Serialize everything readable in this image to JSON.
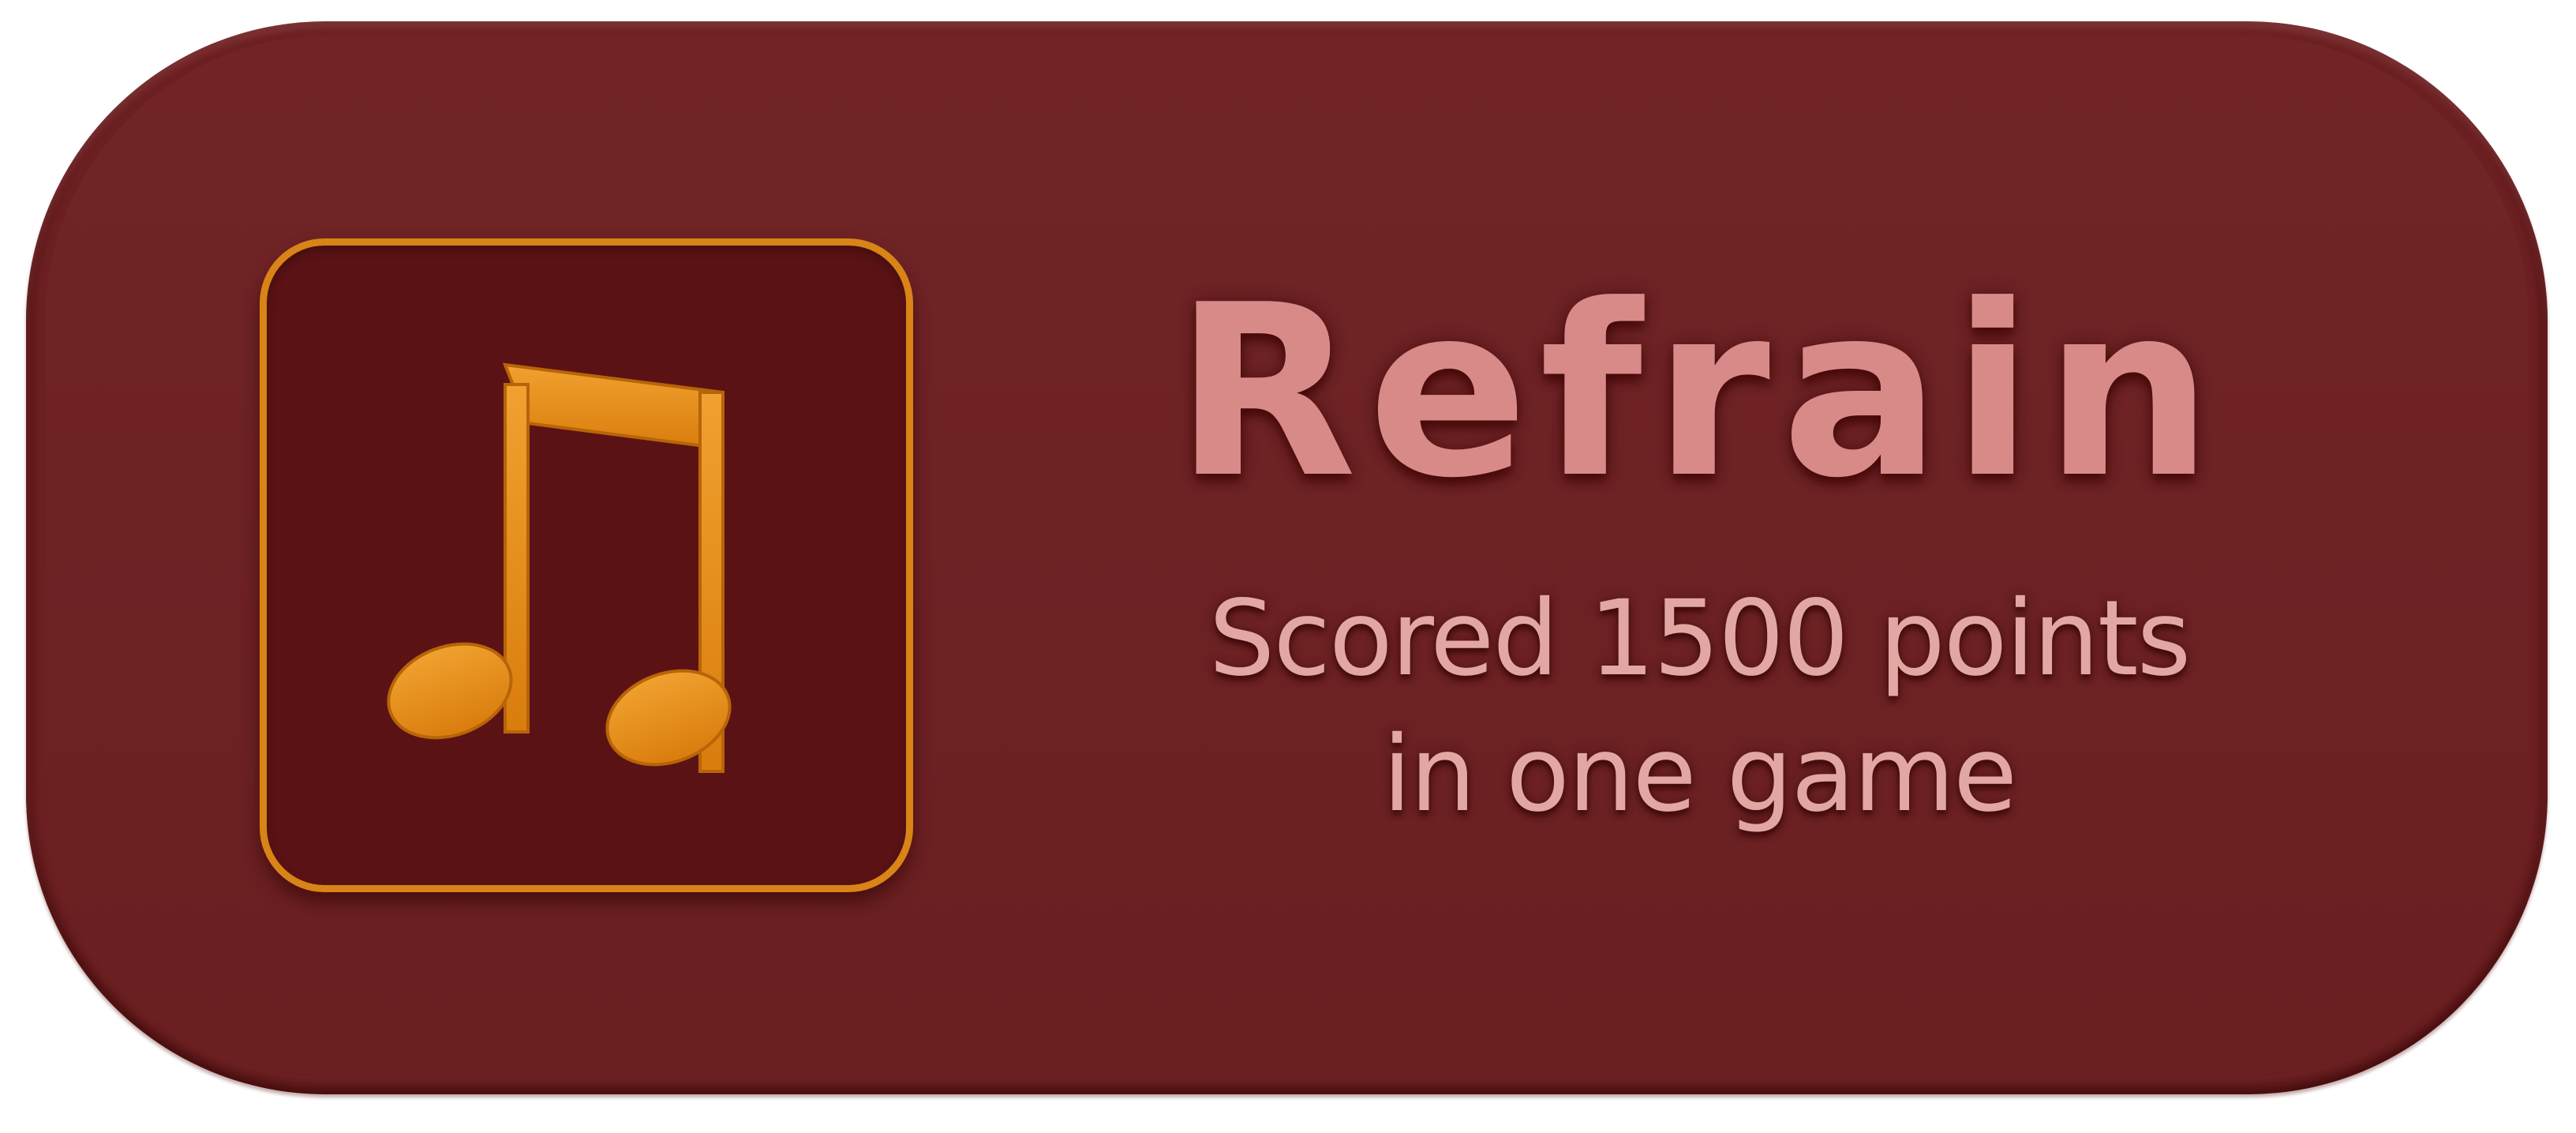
{
  "achievement": {
    "title": "Refrain",
    "description_line1": "Scored 1500 points",
    "description_line2": "in one game",
    "icon": "music-note-icon"
  },
  "colors": {
    "card_background": "#6d2022",
    "tile_background": "#5b1214",
    "tile_border": "#d88416",
    "icon_orange": "#e08a14",
    "title_pink": "#d88a89",
    "subtitle_pink": "#e3a7a3"
  }
}
